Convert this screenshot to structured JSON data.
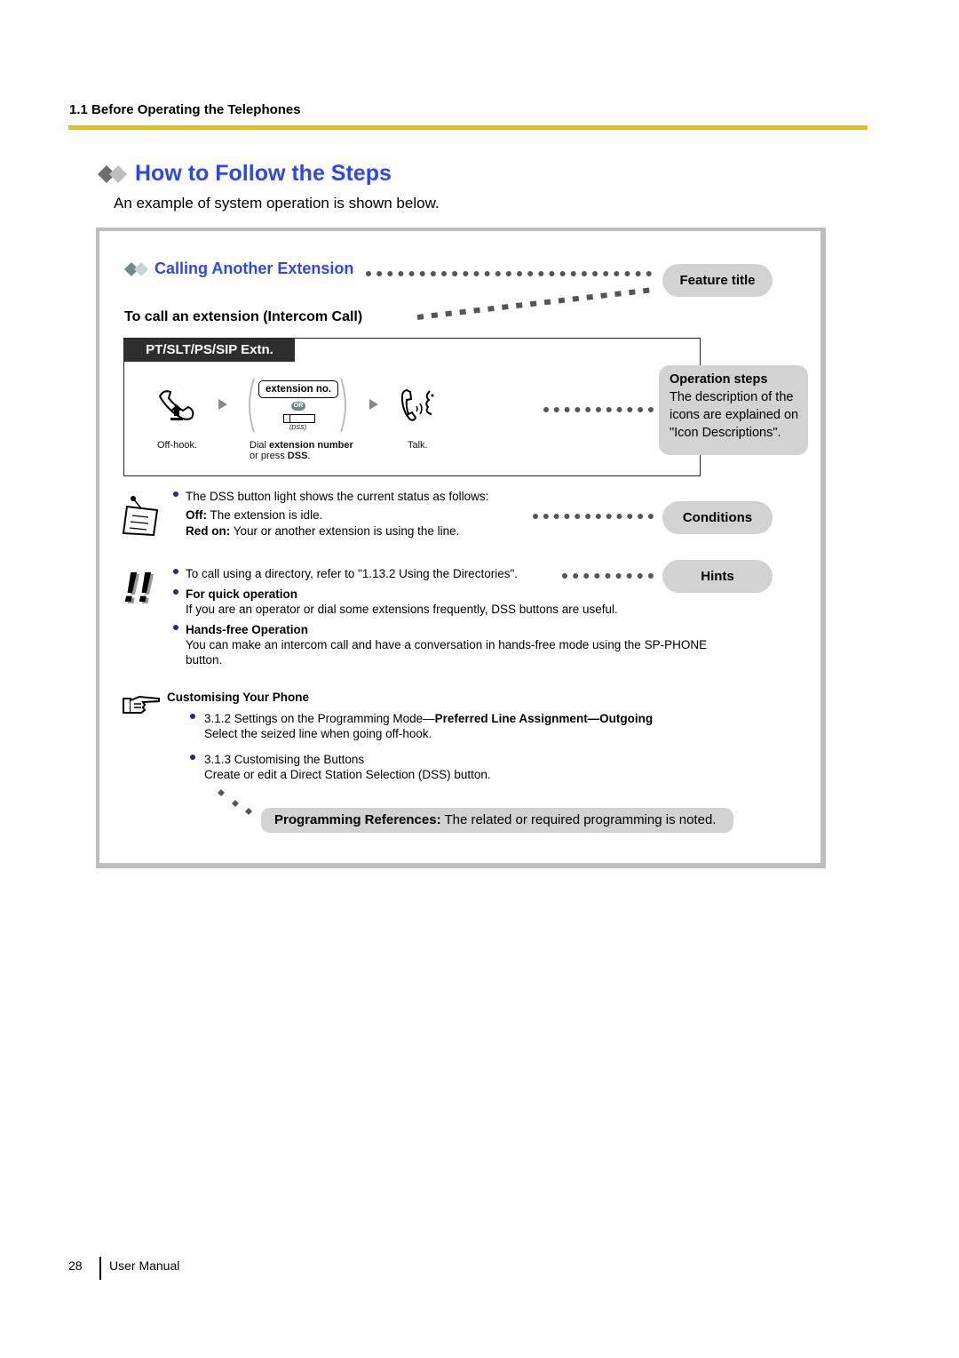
{
  "header": {
    "section": "1.1 Before Operating the Telephones",
    "rule_color": "#e0c400"
  },
  "page": {
    "title": "How to Follow the Steps",
    "title_color": "#2c47f0",
    "intro": "An example of system operation is shown below."
  },
  "example": {
    "feature_title": "Calling Another Extension",
    "sub_heading": "To call an extension (Intercom Call)",
    "tab_label": "PT/SLT/PS/SIP Extn.",
    "steps": [
      {
        "icon": "off-hook-icon",
        "caption": "Off-hook."
      },
      {
        "icon": "dial-icon",
        "input_label": "extension no.",
        "or_label": "OR",
        "dss_label": "(DSS)",
        "caption_prefix": "Dial ",
        "caption_bold": "extension number",
        "caption_line2_prefix": "or press ",
        "caption_line2_bold": "DSS",
        "caption_line2_suffix": "."
      },
      {
        "icon": "talk-icon",
        "caption": "Talk."
      }
    ],
    "conditions": {
      "intro": "The DSS button light shows the current status as follows:",
      "items": [
        {
          "label": "Off:",
          "text": " The extension is idle."
        },
        {
          "label": "Red on:",
          "text": " Your or another extension is using the line."
        }
      ]
    },
    "hints": [
      {
        "title": "",
        "text": "To call using a directory, refer to \"1.13.2 Using the Directories\"."
      },
      {
        "title": "For quick operation",
        "text": "If you are an operator or dial some extensions frequently, DSS buttons are useful."
      },
      {
        "title": "Hands-free Operation",
        "text": "You can make an intercom call and have a conversation in hands-free mode using the SP-PHONE button."
      }
    ],
    "customising": {
      "heading": "Customising Your Phone",
      "items": [
        {
          "prefix": "3.1.2 Settings on the Programming Mode—",
          "bold": "Preferred Line Assignment—Outgoing",
          "desc": "Select the seized line when going off-hook."
        },
        {
          "prefix": "3.1.3 Customising the Buttons",
          "bold": "",
          "desc": "Create or edit a Direct Station Selection (DSS) button."
        }
      ]
    }
  },
  "callouts": {
    "feature_title": "Feature title",
    "operation_steps_title": "Operation steps",
    "operation_steps_text": "The description of the icons are explained on \"Icon Descriptions\".",
    "conditions": "Conditions",
    "hints": "Hints",
    "programming_label": "Programming References:",
    "programming_text": " The related or required programming is noted."
  },
  "footer": {
    "page_number": "28",
    "label": "User Manual"
  }
}
